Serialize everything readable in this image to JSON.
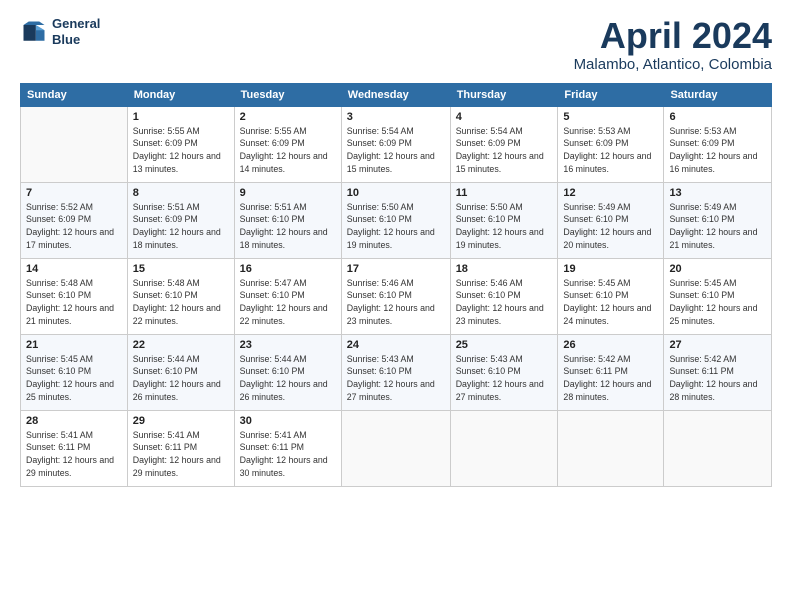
{
  "header": {
    "logo_line1": "General",
    "logo_line2": "Blue",
    "title": "April 2024",
    "location": "Malambo, Atlantico, Colombia"
  },
  "weekdays": [
    "Sunday",
    "Monday",
    "Tuesday",
    "Wednesday",
    "Thursday",
    "Friday",
    "Saturday"
  ],
  "weeks": [
    [
      {
        "day": "",
        "sunrise": "",
        "sunset": "",
        "daylight": ""
      },
      {
        "day": "1",
        "sunrise": "5:55 AM",
        "sunset": "6:09 PM",
        "daylight": "12 hours and 13 minutes."
      },
      {
        "day": "2",
        "sunrise": "5:55 AM",
        "sunset": "6:09 PM",
        "daylight": "12 hours and 14 minutes."
      },
      {
        "day": "3",
        "sunrise": "5:54 AM",
        "sunset": "6:09 PM",
        "daylight": "12 hours and 15 minutes."
      },
      {
        "day": "4",
        "sunrise": "5:54 AM",
        "sunset": "6:09 PM",
        "daylight": "12 hours and 15 minutes."
      },
      {
        "day": "5",
        "sunrise": "5:53 AM",
        "sunset": "6:09 PM",
        "daylight": "12 hours and 16 minutes."
      },
      {
        "day": "6",
        "sunrise": "5:53 AM",
        "sunset": "6:09 PM",
        "daylight": "12 hours and 16 minutes."
      }
    ],
    [
      {
        "day": "7",
        "sunrise": "5:52 AM",
        "sunset": "6:09 PM",
        "daylight": "12 hours and 17 minutes."
      },
      {
        "day": "8",
        "sunrise": "5:51 AM",
        "sunset": "6:09 PM",
        "daylight": "12 hours and 18 minutes."
      },
      {
        "day": "9",
        "sunrise": "5:51 AM",
        "sunset": "6:10 PM",
        "daylight": "12 hours and 18 minutes."
      },
      {
        "day": "10",
        "sunrise": "5:50 AM",
        "sunset": "6:10 PM",
        "daylight": "12 hours and 19 minutes."
      },
      {
        "day": "11",
        "sunrise": "5:50 AM",
        "sunset": "6:10 PM",
        "daylight": "12 hours and 19 minutes."
      },
      {
        "day": "12",
        "sunrise": "5:49 AM",
        "sunset": "6:10 PM",
        "daylight": "12 hours and 20 minutes."
      },
      {
        "day": "13",
        "sunrise": "5:49 AM",
        "sunset": "6:10 PM",
        "daylight": "12 hours and 21 minutes."
      }
    ],
    [
      {
        "day": "14",
        "sunrise": "5:48 AM",
        "sunset": "6:10 PM",
        "daylight": "12 hours and 21 minutes."
      },
      {
        "day": "15",
        "sunrise": "5:48 AM",
        "sunset": "6:10 PM",
        "daylight": "12 hours and 22 minutes."
      },
      {
        "day": "16",
        "sunrise": "5:47 AM",
        "sunset": "6:10 PM",
        "daylight": "12 hours and 22 minutes."
      },
      {
        "day": "17",
        "sunrise": "5:46 AM",
        "sunset": "6:10 PM",
        "daylight": "12 hours and 23 minutes."
      },
      {
        "day": "18",
        "sunrise": "5:46 AM",
        "sunset": "6:10 PM",
        "daylight": "12 hours and 23 minutes."
      },
      {
        "day": "19",
        "sunrise": "5:45 AM",
        "sunset": "6:10 PM",
        "daylight": "12 hours and 24 minutes."
      },
      {
        "day": "20",
        "sunrise": "5:45 AM",
        "sunset": "6:10 PM",
        "daylight": "12 hours and 25 minutes."
      }
    ],
    [
      {
        "day": "21",
        "sunrise": "5:45 AM",
        "sunset": "6:10 PM",
        "daylight": "12 hours and 25 minutes."
      },
      {
        "day": "22",
        "sunrise": "5:44 AM",
        "sunset": "6:10 PM",
        "daylight": "12 hours and 26 minutes."
      },
      {
        "day": "23",
        "sunrise": "5:44 AM",
        "sunset": "6:10 PM",
        "daylight": "12 hours and 26 minutes."
      },
      {
        "day": "24",
        "sunrise": "5:43 AM",
        "sunset": "6:10 PM",
        "daylight": "12 hours and 27 minutes."
      },
      {
        "day": "25",
        "sunrise": "5:43 AM",
        "sunset": "6:10 PM",
        "daylight": "12 hours and 27 minutes."
      },
      {
        "day": "26",
        "sunrise": "5:42 AM",
        "sunset": "6:11 PM",
        "daylight": "12 hours and 28 minutes."
      },
      {
        "day": "27",
        "sunrise": "5:42 AM",
        "sunset": "6:11 PM",
        "daylight": "12 hours and 28 minutes."
      }
    ],
    [
      {
        "day": "28",
        "sunrise": "5:41 AM",
        "sunset": "6:11 PM",
        "daylight": "12 hours and 29 minutes."
      },
      {
        "day": "29",
        "sunrise": "5:41 AM",
        "sunset": "6:11 PM",
        "daylight": "12 hours and 29 minutes."
      },
      {
        "day": "30",
        "sunrise": "5:41 AM",
        "sunset": "6:11 PM",
        "daylight": "12 hours and 30 minutes."
      },
      {
        "day": "",
        "sunrise": "",
        "sunset": "",
        "daylight": ""
      },
      {
        "day": "",
        "sunrise": "",
        "sunset": "",
        "daylight": ""
      },
      {
        "day": "",
        "sunrise": "",
        "sunset": "",
        "daylight": ""
      },
      {
        "day": "",
        "sunrise": "",
        "sunset": "",
        "daylight": ""
      }
    ]
  ],
  "labels": {
    "sunrise_prefix": "Sunrise: ",
    "sunset_prefix": "Sunset: ",
    "daylight_prefix": "Daylight: "
  }
}
